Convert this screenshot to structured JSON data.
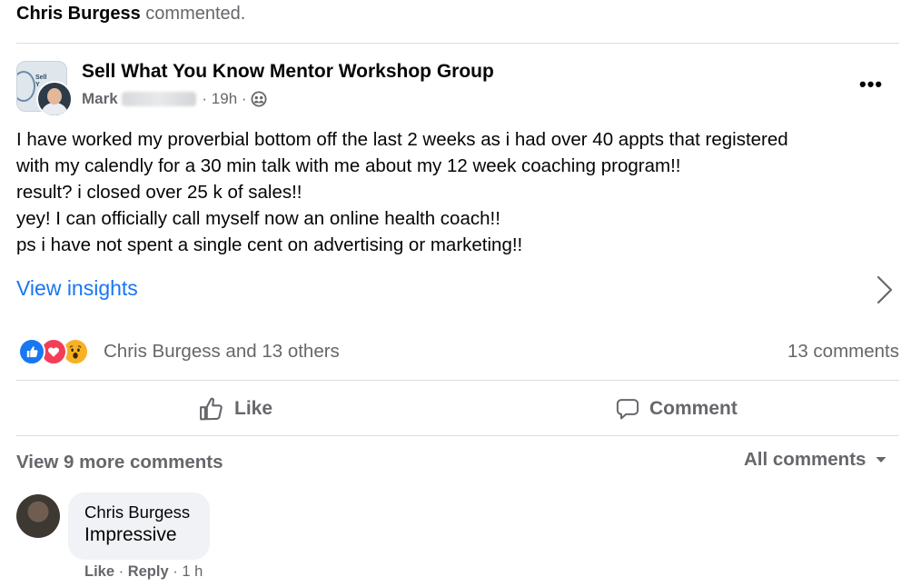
{
  "activity": {
    "actor": "Chris Burgess",
    "action": "commented."
  },
  "post": {
    "group_name": "Sell What You Know Mentor Workshop Group",
    "author": "Mark",
    "time": "19h",
    "audience_icon": "group-audience-icon",
    "body": "I have worked my proverbial bottom off the last 2 weeks as i had over 40 appts that registered\nwith my calendly for a 30 min talk with me about my 12 week coaching program!!\nresult? i closed over 25 k of sales!!\nyey! I can officially call myself now an online health coach!!\nps i have not spent a single cent on advertising or marketing!!",
    "insights_label": "View insights"
  },
  "reactions": {
    "icons": [
      "like-reaction-icon",
      "love-reaction-icon",
      "wow-reaction-icon"
    ],
    "summary": "Chris Burgess and 13 others",
    "comments_count": "13 comments"
  },
  "actions": {
    "like": "Like",
    "comment": "Comment"
  },
  "comments_section": {
    "view_more": "View 9 more comments",
    "filter": "All comments",
    "comments": [
      {
        "author": "Chris Burgess",
        "text": "Impressive",
        "like": "Like",
        "reply": "Reply",
        "time": "1 h"
      }
    ]
  },
  "colors": {
    "link": "#1877f2",
    "secondary_text": "#65676b",
    "like": "#1877f2",
    "love": "#f33e58",
    "wow": "#f7b125"
  }
}
